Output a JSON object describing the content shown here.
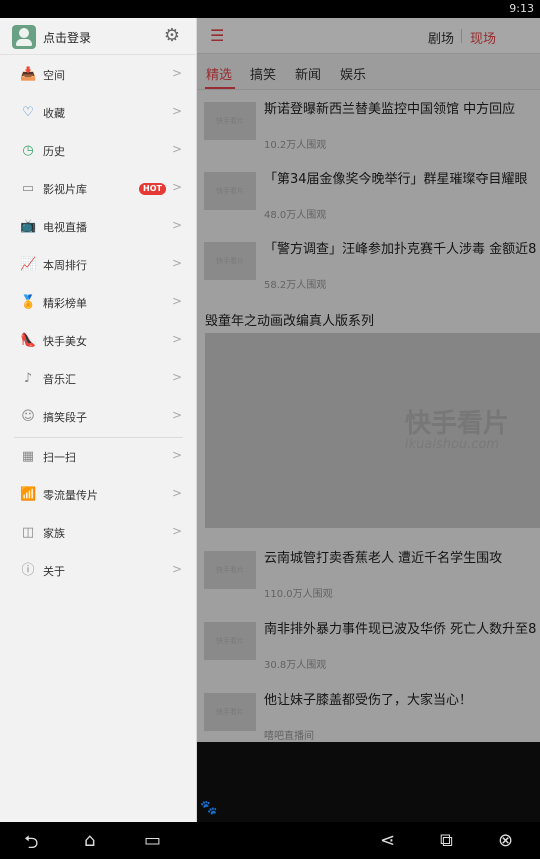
{
  "status": {
    "time": "9:13"
  },
  "header": {
    "menu_icon": "hamburger-icon",
    "tab_theater": "剧场",
    "tab_live": "现场"
  },
  "subtabs": [
    "精选",
    "搞笑",
    "新闻",
    "娱乐"
  ],
  "news": [
    {
      "title": "斯诺登曝新西兰替美监控中国领馆 中方回应",
      "meta": "10.2万人围观"
    },
    {
      "title": "「第34届金像奖今晚举行」群星璀璨夺目耀眼",
      "meta": "48.0万人围观"
    },
    {
      "title": "「警方调查」汪峰参加扑克赛千人涉毒 金额近8",
      "meta": "58.2万人围观"
    }
  ],
  "series_title": "毁童年之动画改编真人版系列",
  "banner": {
    "watermark": "快手看片",
    "watermark_sub": "ikuaishou.com"
  },
  "news2": [
    {
      "title": "云南城管打卖香蕉老人 遭近千名学生围攻",
      "meta": "110.0万人围观"
    },
    {
      "title": "南非排外暴力事件现已波及华侨 死亡人数升至8",
      "meta": "30.8万人围观"
    },
    {
      "title": "他让妹子膝盖都受伤了，大家当心！",
      "meta": "嘻吧直播间"
    }
  ],
  "thumb_placeholder": "快手看片",
  "drawer": {
    "login": "点击登录",
    "items": [
      {
        "label": "空间",
        "icon": "inbox-icon"
      },
      {
        "label": "收藏",
        "icon": "heart-icon"
      },
      {
        "label": "历史",
        "icon": "clock-icon"
      },
      {
        "label": "影视片库",
        "icon": "film-icon",
        "badge": "HOT"
      },
      {
        "label": "电视直播",
        "icon": "tv-icon"
      },
      {
        "label": "本周排行",
        "icon": "chart-icon"
      },
      {
        "label": "精彩榜单",
        "icon": "medal-icon"
      },
      {
        "label": "快手美女",
        "icon": "heels-icon"
      },
      {
        "label": "音乐汇",
        "icon": "music-icon"
      },
      {
        "label": "搞笑段子",
        "icon": "smile-icon"
      },
      {
        "label": "扫一扫",
        "icon": "qr-icon"
      },
      {
        "label": "零流量传片",
        "icon": "wifi-icon"
      },
      {
        "label": "家族",
        "icon": "cube-icon"
      },
      {
        "label": "关于",
        "icon": "info-icon"
      }
    ]
  },
  "colors": {
    "accent": "#e8464a",
    "badge": "#e53935"
  }
}
